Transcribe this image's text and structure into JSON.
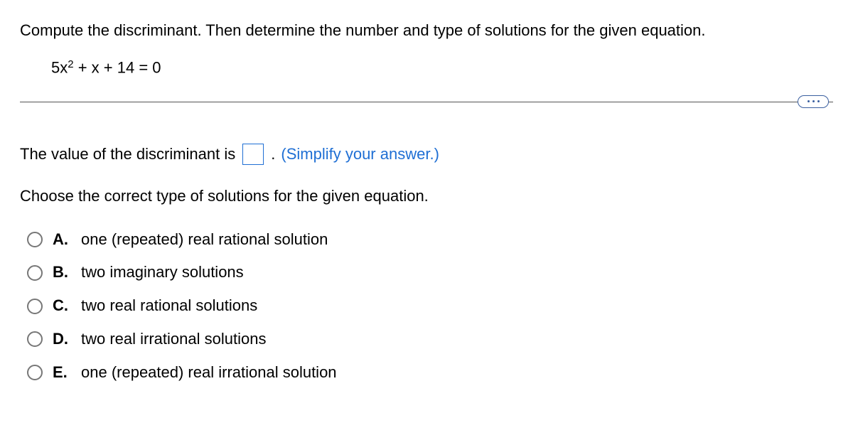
{
  "instruction": "Compute the discriminant. Then determine the number and type of solutions for the given equation.",
  "equation": {
    "coef_a": "5x",
    "sup": "2",
    "rest": " + x + 14 = 0"
  },
  "question1": {
    "prefix": "The value of the discriminant is ",
    "suffix": ".",
    "hint": "(Simplify your answer.)"
  },
  "chooseLine": "Choose the correct type of solutions for the given equation.",
  "options": [
    {
      "letter": "A.",
      "text": "one (repeated) real rational solution"
    },
    {
      "letter": "B.",
      "text": "two imaginary solutions"
    },
    {
      "letter": "C.",
      "text": "two real rational solutions"
    },
    {
      "letter": "D.",
      "text": "two real irrational solutions"
    },
    {
      "letter": "E.",
      "text": "one (repeated) real irrational solution"
    }
  ]
}
